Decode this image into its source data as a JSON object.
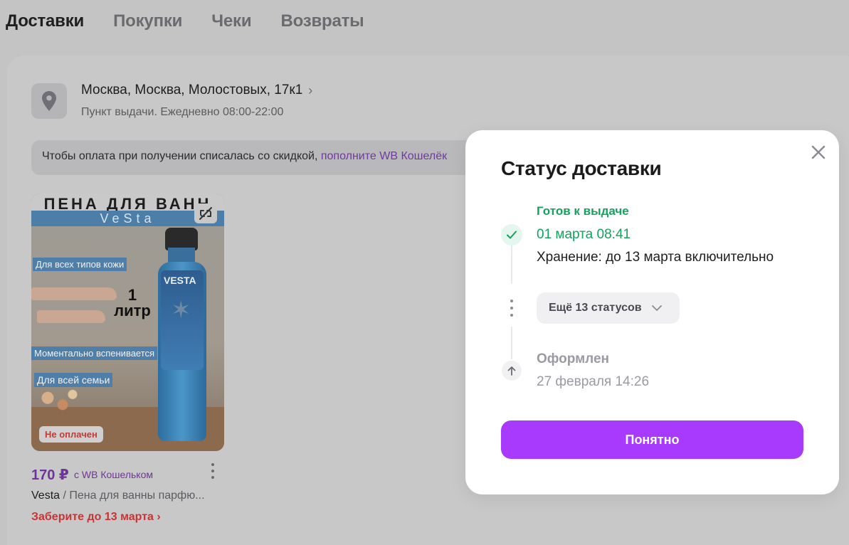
{
  "tabs": [
    {
      "label": "Доставки",
      "active": true
    },
    {
      "label": "Покупки",
      "active": false
    },
    {
      "label": "Чеки",
      "active": false
    },
    {
      "label": "Возвраты",
      "active": false
    }
  ],
  "delivery": {
    "address": "Москва, Москва, Молостовых, 17к1",
    "pickup_point": "Пункт выдачи. Ежедневно 08:00-22:00",
    "notice_text": "Чтобы оплата при получении списалась со скидкой, ",
    "notice_link": "пополните WB Кошелёк"
  },
  "product": {
    "image_title": "ПЕНА ДЛЯ ВАНН",
    "image_brand": "VeSta",
    "image_bottle_text": "VESTA",
    "image_labels": [
      "Для всех типов кожи",
      "Моментально вспенивается",
      "Для всей семьи"
    ],
    "image_volume": "1 литр",
    "payment_badge": "Не оплачен",
    "price": "170 ₽",
    "price_note": "с WB Кошельком",
    "brand": "Vesta",
    "name": " / Пена для ванны парфю...",
    "pickup_deadline": "Заберите до 13 марта"
  },
  "modal": {
    "title": "Статус доставки",
    "status_current": {
      "title": "Готов к выдаче",
      "date": "01 марта 08:41",
      "note": "Хранение: до 13 марта включительно"
    },
    "more_statuses_label": "Ещё 13 статусов",
    "status_initial": {
      "title": "Оформлен",
      "date": "27 февраля 14:26"
    },
    "ok_button": "Понятно"
  },
  "colors": {
    "accent": "#a73afd",
    "success": "#12a35d",
    "error": "#c63535",
    "price": "#6e3599"
  }
}
